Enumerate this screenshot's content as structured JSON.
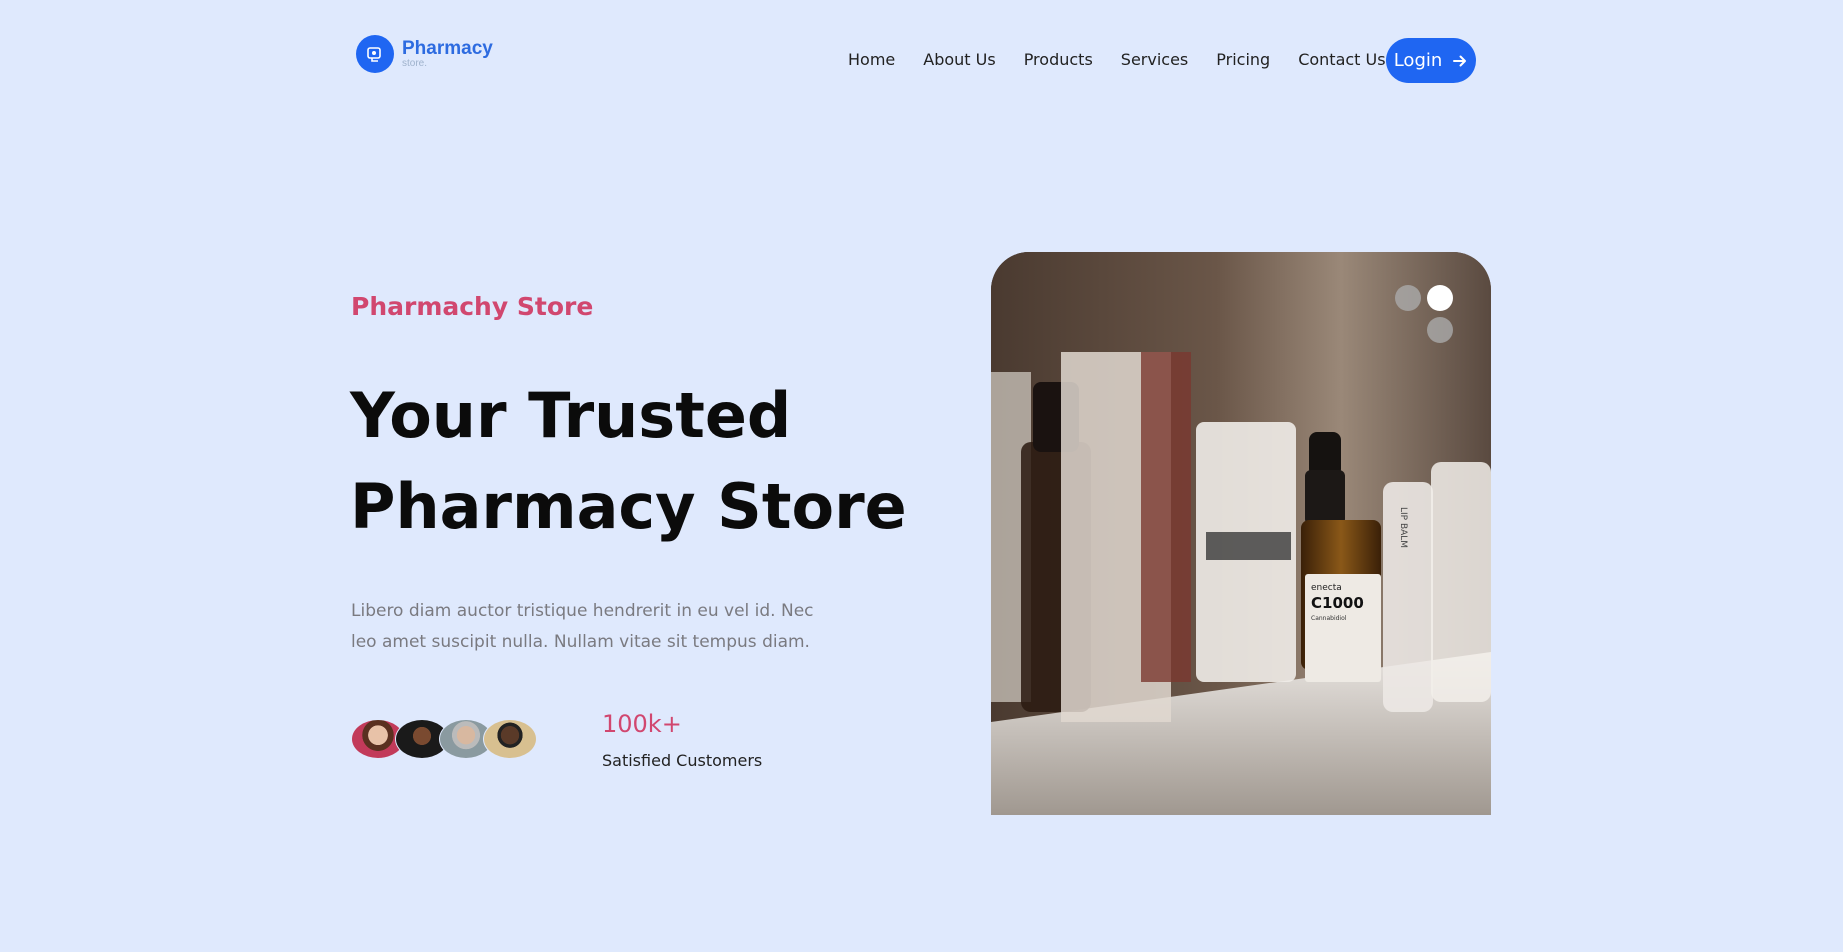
{
  "brand": {
    "name": "Pharmacy",
    "subtitle": "store.",
    "color": "#1f66f2"
  },
  "nav": {
    "items": [
      "Home",
      "About Us",
      "Products",
      "Services",
      "Pricing",
      "Contact Us"
    ],
    "login_label": "Login",
    "login_icon": "arrow-right-icon"
  },
  "hero": {
    "eyebrow": "Pharmachy Store",
    "title_line1": "Your Trusted",
    "title_line2": "Pharmacy Store",
    "description": "Libero diam auctor tristique hendrerit in eu vel id. Nec leo amet suscipit nulla. Nullam vitae sit tempus diam.",
    "stat_value": "100k+",
    "stat_label": "Satisfied Customers",
    "accent_color": "#d1476f"
  },
  "carousel": {
    "product_label": "C1000",
    "product_brand": "enecta",
    "product_sub": "Cannabidiol",
    "side_label": "LIP BALM"
  }
}
